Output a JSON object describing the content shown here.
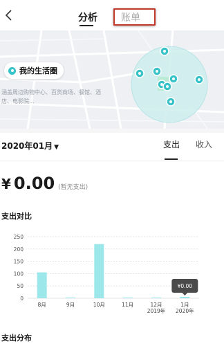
{
  "nav": {
    "back_icon": "chevron-left-icon",
    "tab_analysis": "分析",
    "tab_bills": "账单",
    "highlight_color": "#c0392b"
  },
  "map": {
    "life_circle_label": "我的生活圈",
    "description": "涵盖周边购物中心、百货商场、餐馆、酒店、电影院...",
    "accent": "#37c3c7"
  },
  "summary": {
    "month": "2020年01月",
    "tab_expense": "支出",
    "tab_income": "收入",
    "currency": "¥",
    "amount": "0.00",
    "note": "(暂无支出)"
  },
  "sections": {
    "comparison_title": "支出对比",
    "distribution_title": "支出分布"
  },
  "chart_data": {
    "type": "bar",
    "categories": [
      "8月",
      "9月",
      "10月",
      "11月",
      "12月\n2019年",
      "1月\n2020年"
    ],
    "values": [
      105,
      3,
      220,
      3,
      3,
      0
    ],
    "ylim": [
      0,
      250
    ],
    "yticks": [
      0,
      50,
      100,
      150,
      200,
      250
    ],
    "grid": true,
    "bar_color": "#9be7ea",
    "tooltip": "¥0.00",
    "title": "",
    "xlabel": "",
    "ylabel": ""
  }
}
